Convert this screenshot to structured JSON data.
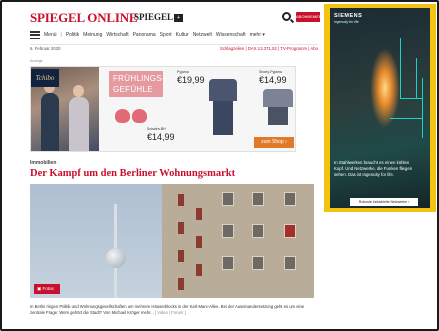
{
  "header": {
    "logo": "SPIEGEL ONLINE",
    "logo2": "SPIEGEL",
    "logo2_badge": "+",
    "abo_button": "ABONNEMENT"
  },
  "nav": {
    "items": [
      "Menü",
      "Politik",
      "Meinung",
      "Wirtschaft",
      "Panorama",
      "Sport",
      "Kultur",
      "Netzwelt",
      "Wissenschaft",
      "mehr ▾"
    ]
  },
  "datebar": {
    "date": "6. Februar 2020",
    "right": "Schlagzeilen  |  DAX 13.371,52  |  TV-Programm  |  Abo"
  },
  "ad_banner": {
    "label": "Anzeige",
    "brand": "Tchibo",
    "headline_line1": "FRÜHLINGS-",
    "headline_line2": "GEFÜHLE",
    "product1_label": "Pyjama",
    "product1_price": "€19,99",
    "product2_label": "Shorty-Pyjama",
    "product2_price": "€14,99",
    "product3_label": "Schalen-BH",
    "product3_price": "€14,99",
    "shop_button": "zum Shop ›"
  },
  "article": {
    "kicker": "Immobilien",
    "headline": "Der Kampf um den Berliner Wohnungsmarkt",
    "fotos_button": "Fotos",
    "teaser": "In Berlin ringen Politik und Wohnungsgesellschaften um mehrere Häuserblocks in der Karl-Marx-Allee. Bei der Auseinandersetzung geht es um eine zentrale Frage: Wem gehört die Stadt? Von Michael Kröger mehr...",
    "teaser_more": "[ Video | Forum ]"
  },
  "side_ad": {
    "brand": "SIEMENS",
    "tagline": "Ingenuity for life",
    "text": "In Stahlwerken braucht es einen kühlen Kopf. Und Netzwerke, die Funken fliegen sehen. Das ist Ingenuity for life.",
    "button": "Robuste industrielle Netzwerke ›"
  },
  "colors": {
    "spiegel_red": "#c8102e",
    "ad_yellow": "#f4c211",
    "shop_orange": "#e07a2a",
    "pink_banner": "#e59aa0"
  }
}
